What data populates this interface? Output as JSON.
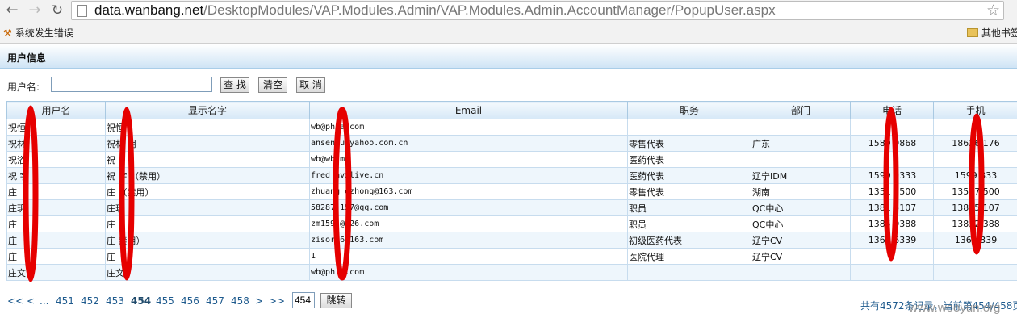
{
  "browser": {
    "url_host": "data.wanbang.net",
    "url_path": "/DesktopModules/VAP.Modules.Admin/VAP.Modules.Admin.AccountManager/PopupUser.aspx",
    "bookmark_left": "系统发生错误",
    "bookmark_right": "其他书签"
  },
  "panel": {
    "title": "用户信息"
  },
  "search": {
    "label": "用户名:",
    "value": "",
    "search_label": "查 找",
    "clear_label": "清空",
    "cancel_label": "取 消"
  },
  "table": {
    "columns": [
      "用户名",
      "显示名字",
      "Email",
      "职务",
      "部门",
      "电话",
      "手机"
    ],
    "rows": [
      [
        "祝恒",
        "祝恒",
        "wb@ph a.com",
        "",
        "",
        "",
        ""
      ],
      [
        "祝林",
        "祝林 明",
        "ansen u@yahoo.com.cn",
        "零售代表",
        "广东",
        "1580 0868",
        "18626 176"
      ],
      [
        "祝浴",
        "祝 Z",
        "wb@wb m",
        "医药代表",
        "",
        "",
        ""
      ],
      [
        "祝 宇",
        "祝 宇 （禁用）",
        "fred hv@live.cn",
        "医药代表",
        "辽宁IDM",
        "1599 9333",
        "1599 333"
      ],
      [
        "庄 ",
        "庄  （禁用）",
        "zhuang dzhong@163.com",
        "零售代表",
        "湖南",
        "1351 7500",
        "13517 500"
      ],
      [
        "庄玥",
        "庄玥 ",
        "58287 157@qq.com",
        "职员",
        "QC中心",
        "1381 5107",
        "13815 107"
      ],
      [
        "庄 ",
        "庄 ",
        "zm159 @ 26.com",
        "职员",
        "QC中心",
        "1385 0388",
        "13852 388"
      ],
      [
        "庄  ",
        "庄  禁用）",
        "zisor 6@163.com",
        "初级医药代表",
        "辽宁CV",
        "1360 6339",
        "1360 339"
      ],
      [
        "庄  ",
        "庄  ",
        "1",
        "医院代理",
        "辽宁CV",
        "",
        ""
      ],
      [
        "庄文 ",
        "庄文 ",
        "wb@ph a.com",
        "",
        "",
        "",
        ""
      ]
    ]
  },
  "pager": {
    "first": "<<",
    "prev": "<",
    "ellipsis": "...",
    "pages": [
      "451",
      "452",
      "453",
      "454",
      "455",
      "456",
      "457",
      "458"
    ],
    "current": "454",
    "next": ">",
    "last": ">>",
    "goto_value": "454",
    "goto_label": "跳转",
    "summary": "共有4572条记录，当前第454/458页"
  },
  "watermark": "www.wooyun.org",
  "colors": {
    "redaction": "#e60000",
    "header_blue": "#cfe4f5",
    "link": "#1f5b8e"
  }
}
